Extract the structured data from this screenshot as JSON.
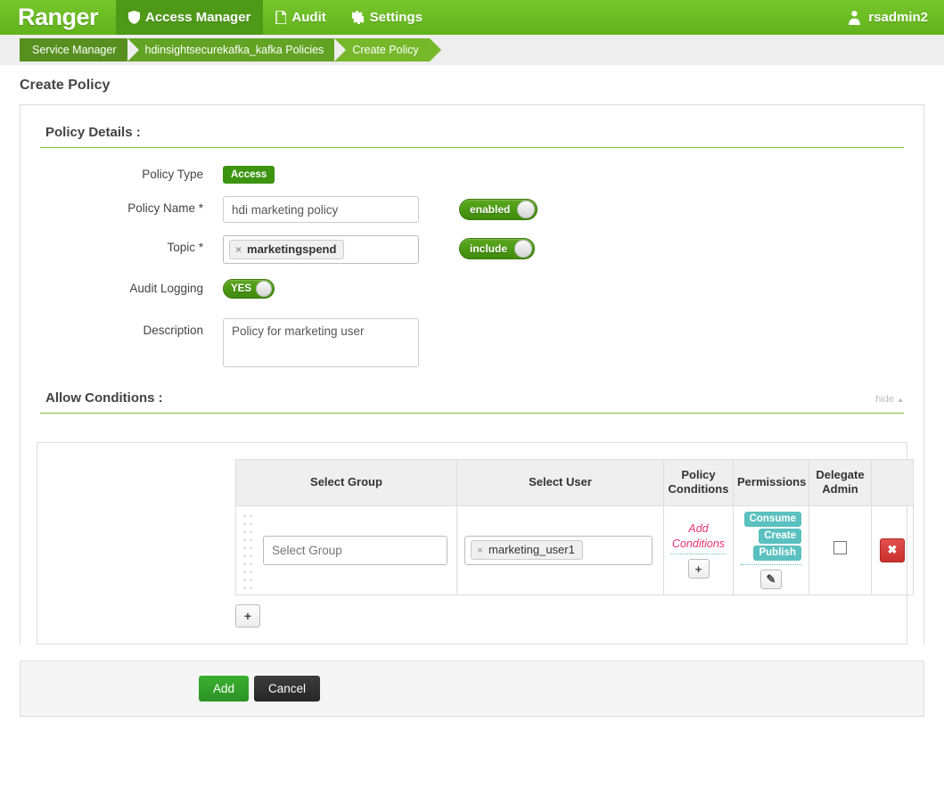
{
  "app": {
    "brand": "Ranger"
  },
  "nav": {
    "items": [
      {
        "label": "Access Manager",
        "icon": "shield-icon",
        "active": true
      },
      {
        "label": "Audit",
        "icon": "file-icon",
        "active": false
      },
      {
        "label": "Settings",
        "icon": "gear-icon",
        "active": false
      }
    ],
    "user": {
      "name": "rsadmin2",
      "icon": "user-avatar-icon"
    }
  },
  "breadcrumb": [
    {
      "label": "Service Manager"
    },
    {
      "label": "hdinsightsecurekafka_kafka Policies"
    },
    {
      "label": "Create Policy"
    }
  ],
  "page": {
    "title": "Create Policy"
  },
  "policy_details": {
    "heading": "Policy Details :",
    "policy_type_label": "Policy Type",
    "policy_type_value": "Access",
    "policy_name_label": "Policy Name *",
    "policy_name_value": "hdi marketing policy",
    "policy_name_placeholder": "Policy Name",
    "enabled_toggle": "enabled",
    "topic_label": "Topic *",
    "topic_value": "marketingspend",
    "topic_remove": "×",
    "include_toggle": "include",
    "audit_logging_label": "Audit Logging",
    "audit_logging_value": "YES",
    "description_label": "Description",
    "description_value": "Policy for marketing user",
    "description_placeholder": "Description"
  },
  "allow_conditions": {
    "heading": "Allow Conditions :",
    "hide_link": "hide",
    "hide_caret": "▲",
    "columns": [
      "Select Group",
      "Select User",
      "Policy Conditions",
      "Permissions",
      "Delegate Admin",
      ""
    ],
    "rows": [
      {
        "group_placeholder": "Select Group",
        "group_value": "",
        "user_chip": "marketing_user1",
        "user_chip_remove": "×",
        "policy_conditions_link": "Add Conditions",
        "add_condition_btn": "+",
        "permissions": [
          "Consume",
          "Create",
          "Publish"
        ],
        "edit_permissions_btn": "✎",
        "delegate_admin_checked": false,
        "delete_btn": "✖"
      }
    ],
    "add_row_btn": "+"
  },
  "footer": {
    "add_label": "Add",
    "cancel_label": "Cancel"
  },
  "colors": {
    "brand_green": "#6cbd24",
    "nav_active": "#4e9a18",
    "accent_green": "#3c9410",
    "permission_teal": "#5bc0c0",
    "add_conditions_pink": "#e8336d",
    "delete_red": "#c9302c"
  }
}
